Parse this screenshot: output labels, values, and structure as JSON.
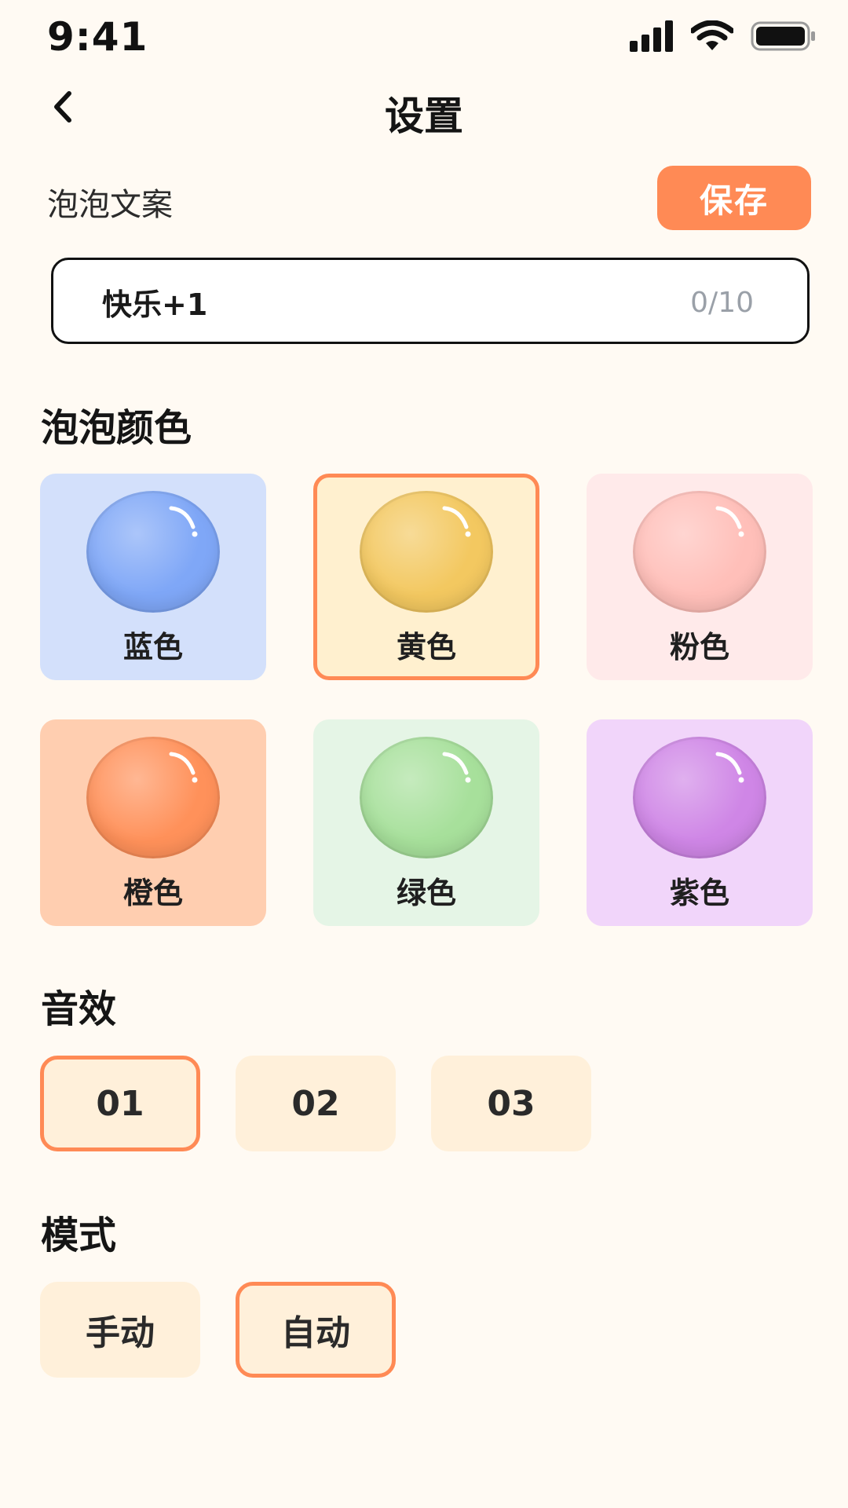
{
  "status_bar": {
    "time": "9:41"
  },
  "header": {
    "title": "设置"
  },
  "bubble_text": {
    "label": "泡泡文案",
    "save_label": "保存",
    "value": "快乐+1",
    "counter": "0/10"
  },
  "bubble_color": {
    "title": "泡泡颜色",
    "selected": "黄色",
    "options": [
      {
        "label": "蓝色",
        "card_bg": "#d3e0fb",
        "bubble_color": "#7fa7f7"
      },
      {
        "label": "黄色",
        "card_bg": "#fff0cf",
        "bubble_color": "#f3c860"
      },
      {
        "label": "粉色",
        "card_bg": "#ffeaea",
        "bubble_color": "#ffbfb9"
      },
      {
        "label": "橙色",
        "card_bg": "#ffceb0",
        "bubble_color": "#ff915a"
      },
      {
        "label": "绿色",
        "card_bg": "#e5f5e6",
        "bubble_color": "#a7e09b"
      },
      {
        "label": "紫色",
        "card_bg": "#f1d5fa",
        "bubble_color": "#cf86e6"
      }
    ]
  },
  "sound_effect": {
    "title": "音效",
    "selected": "01",
    "options": [
      "01",
      "02",
      "03"
    ]
  },
  "mode": {
    "title": "模式",
    "selected": "自动",
    "options": [
      "手动",
      "自动"
    ]
  },
  "colors": {
    "accent": "#ff8a55",
    "background": "#fffaf3",
    "chip_bg": "#fff0da"
  }
}
